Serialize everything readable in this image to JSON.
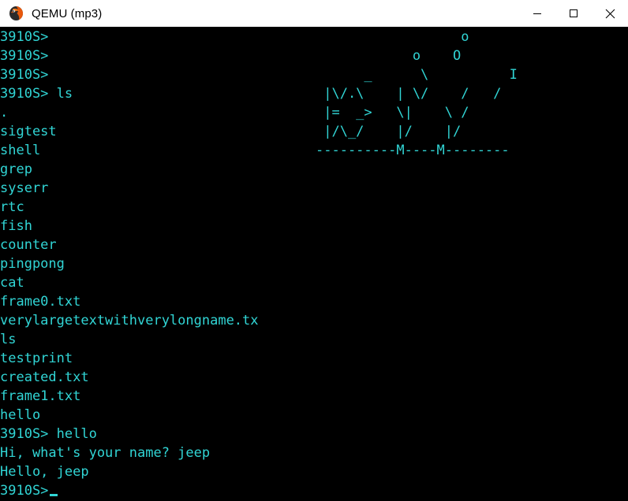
{
  "window": {
    "title": "QEMU (mp3)",
    "icon": "qemu-logo-icon",
    "controls": {
      "minimize_label": "—",
      "maximize_label": "□",
      "close_label": "✕"
    },
    "titlebar_bg": "#ffffff",
    "titlebar_fg": "#000000"
  },
  "terminal": {
    "background": "#000000",
    "foreground": "#31d5d5",
    "prompt": "3910S>",
    "cols": 68,
    "rows": 25,
    "lines": [
      "3910S>",
      "3910S>",
      "3910S>",
      "3910S> ls",
      ".",
      "sigtest",
      "shell",
      "grep",
      "syserr",
      "rtc",
      "fish",
      "counter",
      "pingpong",
      "cat",
      "frame0.txt",
      "verylargetextwithverylongname.tx",
      "ls",
      "testprint",
      "created.txt",
      "frame1.txt",
      "hello",
      "3910S> hello",
      "Hi, what's your name? jeep",
      "Hello, jeep",
      "3910S>"
    ],
    "ascii_art": {
      "name": "fish-ascii-art",
      "lines": [
        "                  o",
        "            o    O",
        "      _      \\          I",
        " |\\/.\\    | \\/    /   /",
        " |=  _>   \\|    \\ /",
        " |/\\_/    |/    |/",
        "----------M----M--------"
      ]
    },
    "cursor": {
      "visible": true,
      "shape": "underscore"
    },
    "commands_run": [
      "ls",
      "hello"
    ],
    "ls_output": [
      ".",
      "sigtest",
      "shell",
      "grep",
      "syserr",
      "rtc",
      "fish",
      "counter",
      "pingpong",
      "cat",
      "frame0.txt",
      "verylargetextwithverylongname.tx",
      "ls",
      "testprint",
      "created.txt",
      "frame1.txt",
      "hello"
    ],
    "hello_prompt": "Hi, what's your name? jeep",
    "hello_response": "Hello, jeep",
    "user_input": "jeep"
  }
}
